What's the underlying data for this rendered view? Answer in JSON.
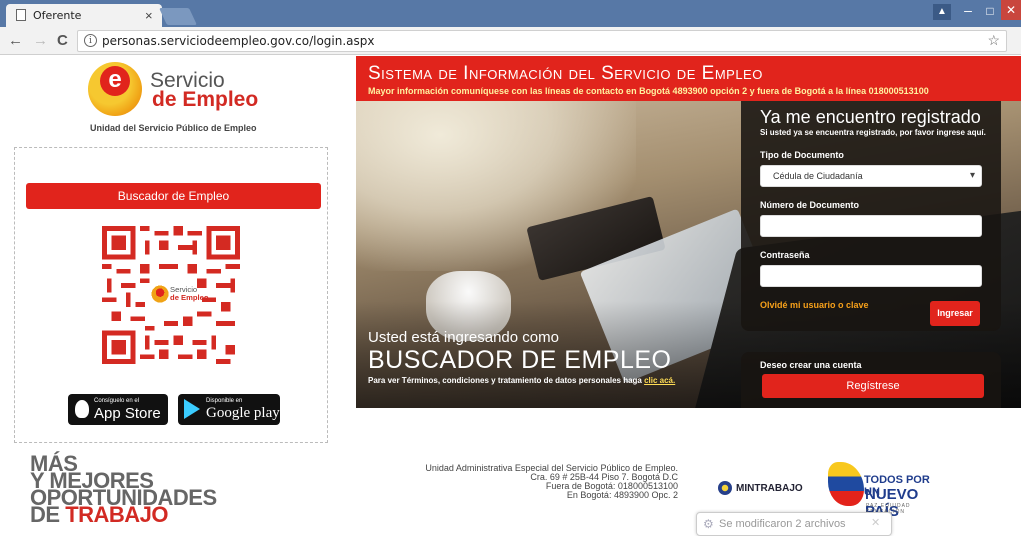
{
  "browser": {
    "tab_title": "Oferente",
    "tab_close": "×",
    "url": "personas.serviciodeempleo.gov.co/login.aspx",
    "back": "←",
    "forward": "→",
    "reload": "C",
    "info": "i",
    "star": "☆",
    "win_user": "▲",
    "win_min": "–",
    "win_max": "□",
    "win_close": "✕"
  },
  "logo": {
    "letter": "e",
    "line1": "Servicio",
    "line2": "de Empleo",
    "unit": "Unidad del Servicio Público de Empleo"
  },
  "left_box": {
    "search_button": "Buscador de Empleo",
    "qr_label_line1": "Servicio",
    "qr_label_line2": "de Empleo",
    "apple_small": "Consíguelo en el",
    "apple_big": "App Store",
    "google_small": "Disponible en",
    "google_big": "Google play"
  },
  "tagline": {
    "l1": "MÁS",
    "l2": "Y MEJORES",
    "l3": "OPORTUNIDADES",
    "l4_pre": "DE ",
    "l4_red": "TRABAJO"
  },
  "banner": {
    "title": "Sistema de Información del Servicio de Empleo",
    "subtitle": "Mayor información comuníquese con las líneas de contacto en Bogotá 4893900 opción 2 y fuera de Bogotá a la línea 018000513100"
  },
  "hero": {
    "line1": "Usted está ingresando como",
    "line2": "BUSCADOR DE EMPLEO",
    "line3_text": "Para ver Términos, condiciones y tratamiento de datos personales haga ",
    "line3_link": "clic acá."
  },
  "login": {
    "title": "Ya me encuentro registrado",
    "subtitle": "Si usted ya se encuentra registrado, por favor ingrese aquí.",
    "doc_type_label": "Tipo de Documento",
    "doc_type_value": "Cédula de Ciudadanía",
    "doc_number_label": "Número de Documento",
    "doc_number_value": "",
    "password_label": "Contraseña",
    "password_value": "",
    "forgot": "Olvidé mi usuario o clave",
    "submit": "Ingresar"
  },
  "register": {
    "label": "Deseo crear una cuenta",
    "button": "Regístrese"
  },
  "footer": {
    "address_l1": "Unidad Administrativa Especial del Servicio Público de Empleo.",
    "address_l2": "Cra. 69 # 25B-44 Piso 7. Bogotá D.C",
    "address_l3": "Fuera de Bogotá: 018000513100",
    "address_l4": "En Bogotá: 4893900 Opc. 2",
    "mintrabajo": "MINTRABAJO",
    "np_l1": "TODOS POR UN",
    "np_l2": "NUEVO PAÍS",
    "np_l3": "PAZ  EQUIDAD  EDUCACIÓN"
  },
  "toast": {
    "text": "Se modificaron 2 archivos",
    "close": "✕"
  },
  "colors": {
    "brand_red": "#e1241c",
    "chrome_blue": "#5778a6",
    "forgot_orange": "#f6a01a"
  }
}
